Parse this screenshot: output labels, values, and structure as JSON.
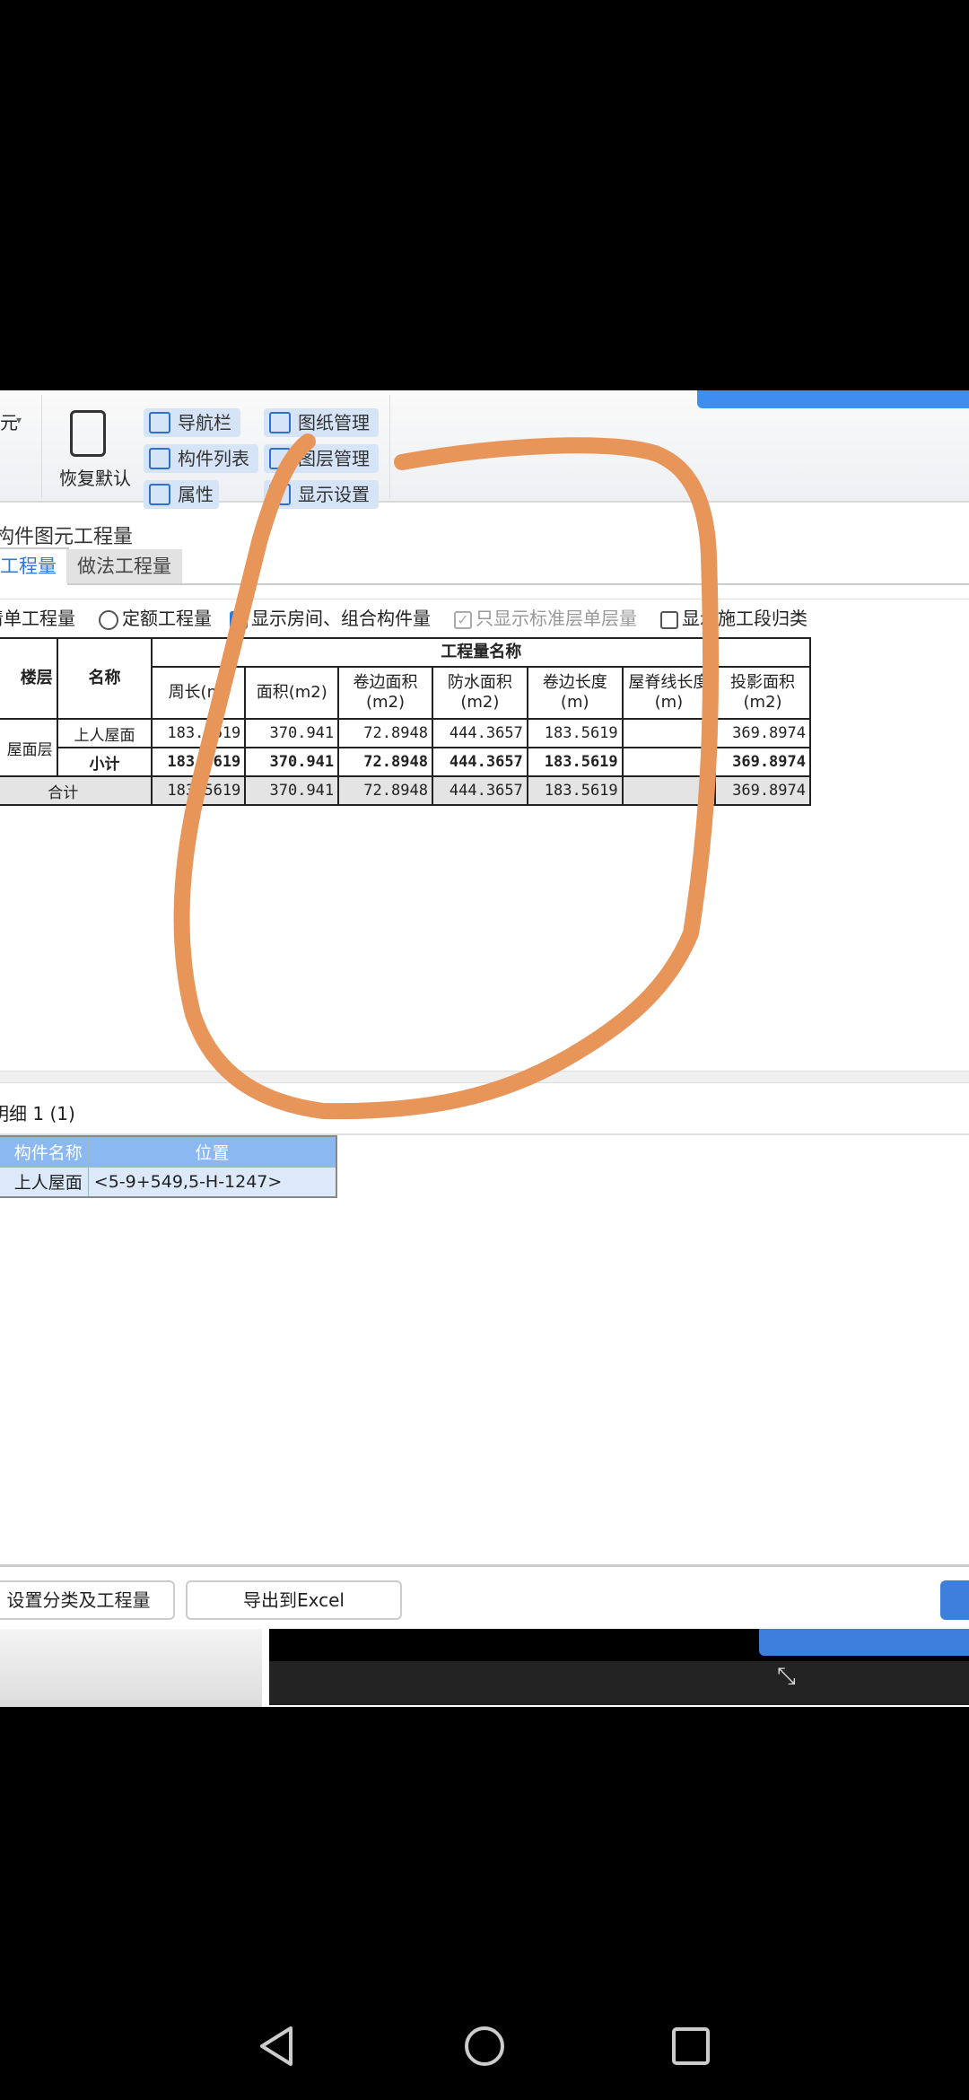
{
  "toolbar": {
    "dropdown_partial": "元",
    "restore_default": "恢复默认",
    "buttons": [
      "导航栏",
      "构件列表",
      "属性",
      "图纸管理",
      "图层管理",
      "显示设置"
    ]
  },
  "panel": {
    "title": "构件图元工程量",
    "tabs": [
      {
        "label": "工程量",
        "active": true
      },
      {
        "label": "做法工程量",
        "active": false
      }
    ],
    "options": [
      {
        "label": "清单工程量",
        "type": "radio",
        "checked": true
      },
      {
        "label": "定额工程量",
        "type": "radio",
        "checked": false
      },
      {
        "label": "显示房间、组合构件量",
        "type": "checkbox",
        "checked": true
      },
      {
        "label": "只显示标准层单层量",
        "type": "checkbox",
        "checked": true,
        "disabled": true
      },
      {
        "label": "显示施工段归类",
        "type": "checkbox",
        "checked": false
      }
    ]
  },
  "quantity_table": {
    "col_floor": "楼层",
    "col_name": "名称",
    "group_header": "工程量名称",
    "columns": [
      "周长(m)",
      "面积(m2)",
      "卷边面积(m2)",
      "防水面积(m2)",
      "卷边长度(m)",
      "屋脊线长度(m)",
      "投影面积(m2)"
    ],
    "floor": "屋面层",
    "rows": [
      {
        "name": "上人屋面",
        "values": [
          "183.5619",
          "370.941",
          "72.8948",
          "444.3657",
          "183.5619",
          "",
          "369.8974"
        ]
      },
      {
        "name": "小计",
        "values": [
          "183.5619",
          "370.941",
          "72.8948",
          "444.3657",
          "183.5619",
          "",
          "369.8974"
        ]
      }
    ],
    "total": {
      "label": "合计",
      "values": [
        "183.5619",
        "370.941",
        "72.8948",
        "444.3657",
        "183.5619",
        "",
        "369.8974"
      ]
    }
  },
  "detail": {
    "label": "明细",
    "count": "1 (1)",
    "columns": [
      "构件名称",
      "位置"
    ],
    "rows": [
      [
        "上人屋面",
        "<5-9+549,5-H-1247>"
      ]
    ]
  },
  "footer": {
    "set_button": "设置分类及工程量",
    "export_button": "导出到Excel"
  },
  "annotation_color": "#e8955a",
  "accent": "#3e8ef0"
}
